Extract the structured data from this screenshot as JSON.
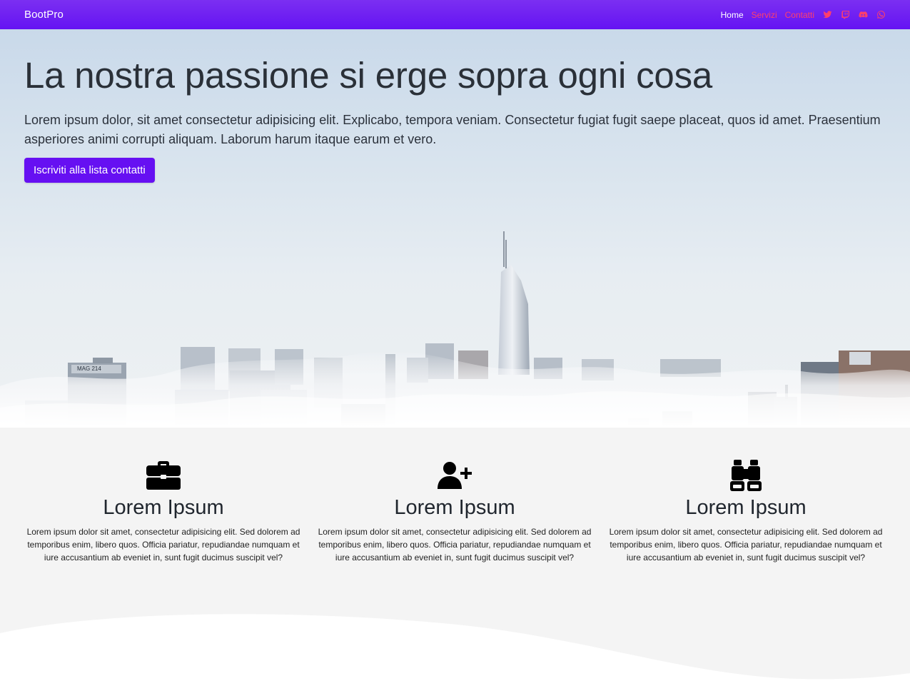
{
  "nav": {
    "brand": "BootPro",
    "links": [
      {
        "label": "Home",
        "active": true
      },
      {
        "label": "Servizi",
        "active": false
      },
      {
        "label": "Contatti",
        "active": false
      }
    ],
    "social_icons": [
      "twitter-icon",
      "twitch-icon",
      "discord-icon",
      "whatsapp-icon"
    ]
  },
  "hero": {
    "title": "La nostra passione si erge sopra ogni cosa",
    "text": "Lorem ipsum dolor, sit amet consectetur adipisicing elit. Explicabo, tempora veniam. Consectetur fugiat fugit saepe placeat, quos id amet. Praesentium asperiores animi corrupti aliquam. Laborum harum itaque earum et vero.",
    "button_label": "Iscriviti alla lista contatti",
    "building_sign": "MAG 214"
  },
  "features": [
    {
      "icon": "briefcase-icon",
      "title": "Lorem Ipsum",
      "text": "Lorem ipsum dolor sit amet, consectetur adipisicing elit. Sed dolorem ad temporibus enim, libero quos. Officia pariatur, repudiandae numquam et iure accusantium ab eveniet in, sunt fugit ducimus suscipit vel?"
    },
    {
      "icon": "user-plus-icon",
      "title": "Lorem Ipsum",
      "text": "Lorem ipsum dolor sit amet, consectetur adipisicing elit. Sed dolorem ad temporibus enim, libero quos. Officia pariatur, repudiandae numquam et iure accusantium ab eveniet in, sunt fugit ducimus suscipit vel?"
    },
    {
      "icon": "binoculars-icon",
      "title": "Lorem Ipsum",
      "text": "Lorem ipsum dolor sit amet, consectetur adipisicing elit. Sed dolorem ad temporibus enim, libero quos. Officia pariatur, repudiandae numquam et iure accusantium ab eveniet in, sunt fugit ducimus suscipit vel?"
    }
  ],
  "colors": {
    "navbar": "#6f1ff3",
    "primary_button": "#6610f2",
    "inactive_link": "#ff3f6c",
    "feature_background": "#f4f4f4"
  }
}
